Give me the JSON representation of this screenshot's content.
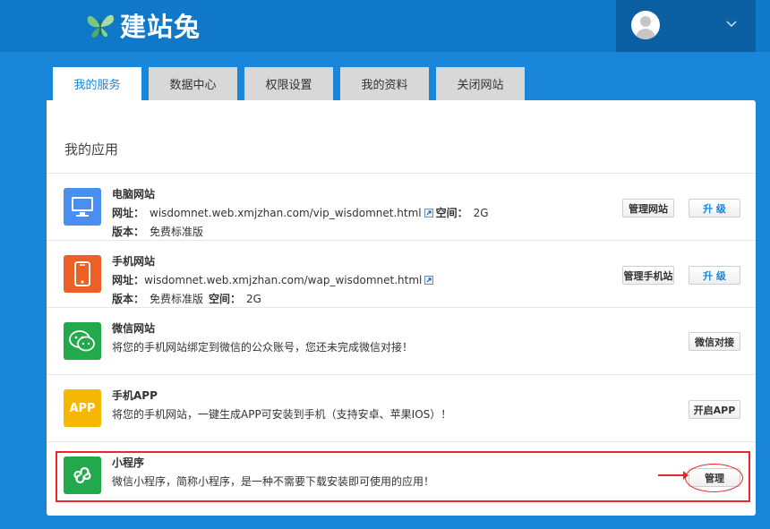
{
  "header": {
    "logo_text": "建站兔",
    "logo_icon": "butterfly-logo-icon",
    "user_icon": "avatar-icon",
    "dropdown_icon": "chevron-down-icon"
  },
  "tabs": [
    {
      "label": "我的服务",
      "active": true
    },
    {
      "label": "数据中心",
      "active": false
    },
    {
      "label": "权限设置",
      "active": false
    },
    {
      "label": "我的资料",
      "active": false
    },
    {
      "label": "关闭网站",
      "active": false
    }
  ],
  "section_title": "我的应用",
  "apps": {
    "pc": {
      "title": "电脑网站",
      "url_label": "网址：",
      "url": "wisdomnet.web.xmjzhan.com/vip_wisdomnet.html",
      "space_label": "空间：",
      "space": "2G",
      "version_label": "版本：",
      "version": "免费标准版",
      "btn_manage": "管理网站",
      "btn_upgrade": "升 级",
      "icon": "monitor-icon",
      "color": "#4a8ff0"
    },
    "mobile": {
      "title": "手机网站",
      "url_label": "网址：",
      "url": "wisdomnet.web.xmjzhan.com/wap_wisdomnet.html",
      "version_label": "版本：",
      "version": "免费标准版",
      "space_label": "空间：",
      "space": "2G",
      "btn_manage": "管理手机站",
      "btn_upgrade": "升 级",
      "icon": "phone-icon",
      "color": "#ec5f25"
    },
    "wechat": {
      "title": "微信网站",
      "desc": "将您的手机网站绑定到微信的公众账号，您还未完成微信对接！",
      "btn": "微信对接",
      "icon": "wechat-icon",
      "color": "#22a94c"
    },
    "app": {
      "title": "手机APP",
      "desc": "将您的手机网站，一键生成APP可安装到手机（支持安卓、苹果IOS）！",
      "btn": "开启APP",
      "icon_text": "APP",
      "icon": "app-icon",
      "color": "#f5b700"
    },
    "mini": {
      "title": "小程序",
      "desc": "微信小程序，简称小程序，是一种不需要下载安装即可使用的应用！",
      "btn": "管理",
      "icon": "mini-program-icon",
      "color": "#22a94c"
    }
  },
  "annotation_color": "#e8262b"
}
